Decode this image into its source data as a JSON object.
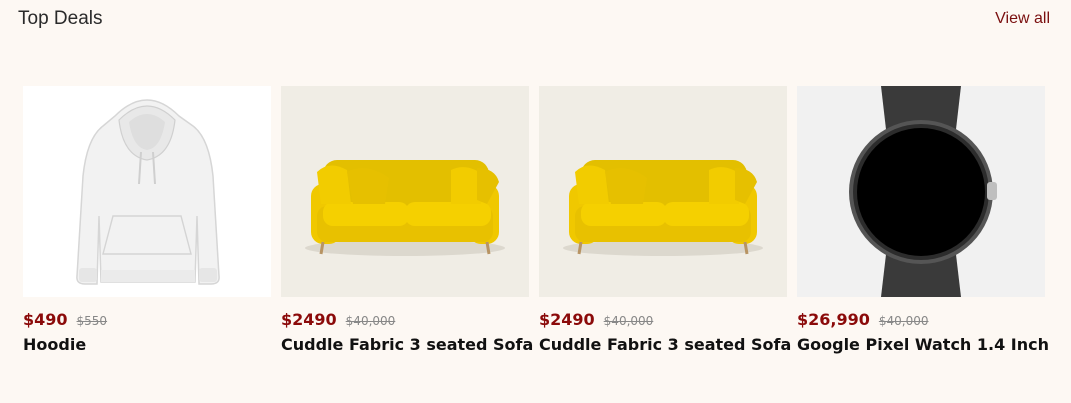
{
  "section": {
    "title": "Top Deals",
    "view_all_label": "View all"
  },
  "products": [
    {
      "price": "$490",
      "old_price": "$550",
      "title": "Hoodie",
      "image": "white-hoodie"
    },
    {
      "price": "$2490",
      "old_price": "$40,000",
      "title": "Cuddle Fabric 3 seated Sofa",
      "image": "yellow-sofa"
    },
    {
      "price": "$2490",
      "old_price": "$40,000",
      "title": "Cuddle Fabric 3 seated Sofa",
      "image": "yellow-sofa"
    },
    {
      "price": "$26,990",
      "old_price": "$40,000",
      "title": "Google Pixel Watch 1.4 Inch",
      "image": "black-smartwatch"
    }
  ],
  "colors": {
    "background": "#fdf8f3",
    "price": "#8b0a0a",
    "link": "#7a0f0f"
  }
}
